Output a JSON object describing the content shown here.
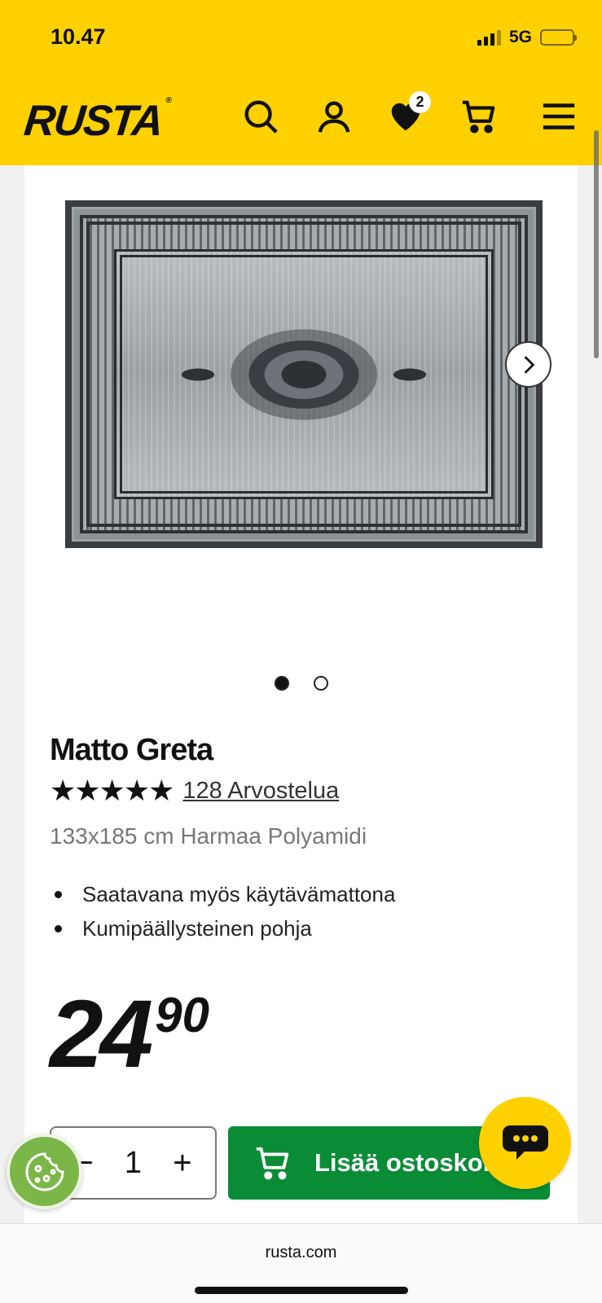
{
  "status": {
    "time": "10.47",
    "network": "5G"
  },
  "header": {
    "logo": "RUSTA",
    "favorites_count": "2",
    "icons": [
      "search-icon",
      "user-icon",
      "heart-icon",
      "cart-icon",
      "menu-icon"
    ]
  },
  "product": {
    "title": "Matto Greta",
    "stars": "★★★★★",
    "reviews": "128 Arvostelua",
    "subtitle": "133x185 cm Harmaa Polyamidi",
    "features": [
      "Saatavana myös käytävämattona",
      "Kumipäällysteinen pohja"
    ],
    "price_main": "24",
    "price_decimals": "90",
    "rating_value": 5,
    "image_count": 2,
    "active_image": 1
  },
  "purchase": {
    "minus": "−",
    "quantity": "1",
    "plus": "+",
    "add_to_cart": "Lisää ostoskoriin"
  },
  "browser": {
    "url": "rusta.com"
  },
  "colors": {
    "brand_yellow": "#ffd100",
    "cta_green": "#0a8c37",
    "cookie_green": "#7ab648"
  }
}
